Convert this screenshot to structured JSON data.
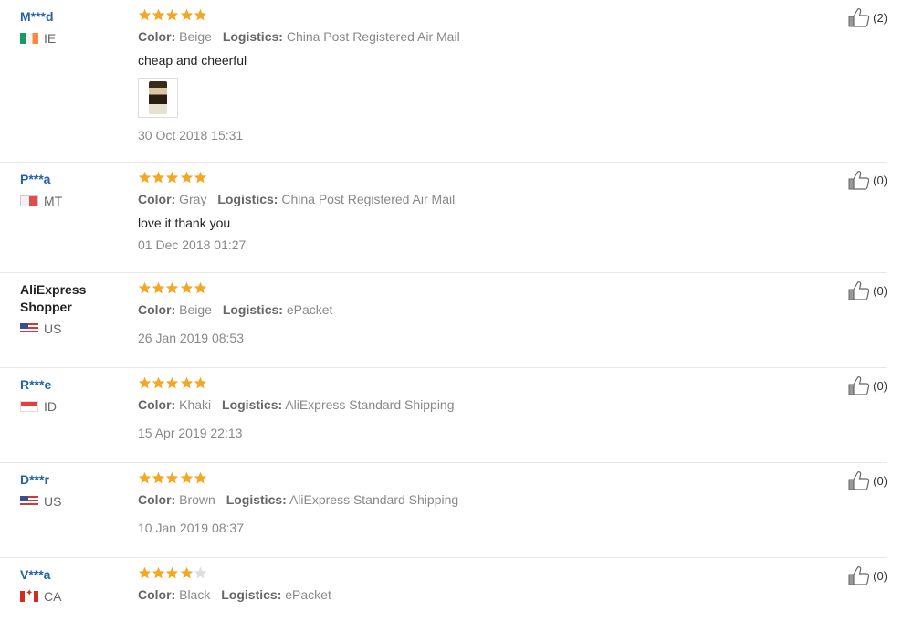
{
  "reviews": [
    {
      "username": "M***d",
      "username_style": "link",
      "country": "IE",
      "flag": "ie",
      "rating": 5,
      "color_label": "Color:",
      "color_value": "Beige",
      "logistics_label": "Logistics:",
      "logistics_value": "China Post Registered Air Mail",
      "text": "cheap and cheerful",
      "has_photo": true,
      "date": "30 Oct 2018 15:31",
      "helpful": "(2)"
    },
    {
      "username": "P***a",
      "username_style": "link",
      "country": "MT",
      "flag": "mt",
      "rating": 5,
      "color_label": "Color:",
      "color_value": "Gray",
      "logistics_label": "Logistics:",
      "logistics_value": "China Post Registered Air Mail",
      "text": "love it thank you",
      "has_photo": false,
      "date": "01 Dec 2018 01:27",
      "helpful": "(0)"
    },
    {
      "username": "AliExpress Shopper",
      "username_style": "plain",
      "country": "US",
      "flag": "us",
      "rating": 5,
      "color_label": "Color:",
      "color_value": "Beige",
      "logistics_label": "Logistics:",
      "logistics_value": "ePacket",
      "text": "",
      "has_photo": false,
      "date": "26 Jan 2019 08:53",
      "helpful": "(0)"
    },
    {
      "username": "R***e",
      "username_style": "link",
      "country": "ID",
      "flag": "id",
      "rating": 5,
      "color_label": "Color:",
      "color_value": "Khaki",
      "logistics_label": "Logistics:",
      "logistics_value": "AliExpress Standard Shipping",
      "text": "",
      "has_photo": false,
      "date": "15 Apr 2019 22:13",
      "helpful": "(0)"
    },
    {
      "username": "D***r",
      "username_style": "link",
      "country": "US",
      "flag": "us",
      "rating": 5,
      "color_label": "Color:",
      "color_value": "Brown",
      "logistics_label": "Logistics:",
      "logistics_value": "AliExpress Standard Shipping",
      "text": "",
      "has_photo": false,
      "date": "10 Jan 2019 08:37",
      "helpful": "(0)"
    },
    {
      "username": "V***a",
      "username_style": "link",
      "country": "CA",
      "flag": "ca",
      "rating": 4,
      "color_label": "Color:",
      "color_value": "Black",
      "logistics_label": "Logistics:",
      "logistics_value": "ePacket",
      "text": "",
      "has_photo": false,
      "date": "",
      "helpful": "(0)"
    }
  ],
  "colors": {
    "star_filled": "#f5a623",
    "star_empty": "#dddddd",
    "username_link": "#2563a8",
    "divider": "#e8e8e8"
  },
  "icons": {
    "rating": "star-icon",
    "helpful": "thumbs-up-icon",
    "country": "flag-icon"
  }
}
